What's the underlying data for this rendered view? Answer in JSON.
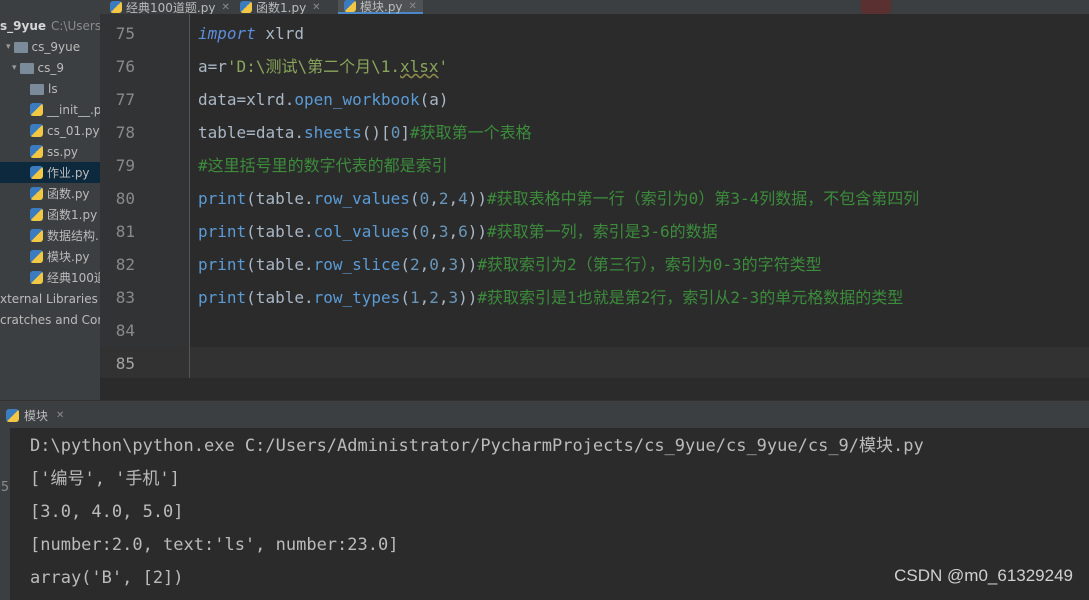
{
  "tabs": [
    {
      "label": "经典100道题.py",
      "active": false
    },
    {
      "label": "函数1.py",
      "active": false
    },
    {
      "label": "模块.py",
      "active": true
    }
  ],
  "project_tree": [
    {
      "label": "s_9yue",
      "note": "C:\\Users\\",
      "type": "root"
    },
    {
      "label": "cs_9yue",
      "type": "folder"
    },
    {
      "label": "cs_9",
      "type": "folder"
    },
    {
      "label": "ls",
      "type": "folder"
    },
    {
      "label": "__init__.py",
      "type": "py"
    },
    {
      "label": "cs_01.py",
      "type": "py"
    },
    {
      "label": "ss.py",
      "type": "py"
    },
    {
      "label": "作业.py",
      "type": "py",
      "selected": true
    },
    {
      "label": "函数.py",
      "type": "py"
    },
    {
      "label": "函数1.py",
      "type": "py"
    },
    {
      "label": "数据结构.",
      "type": "py"
    },
    {
      "label": "模块.py",
      "type": "py"
    },
    {
      "label": "经典100道",
      "type": "py"
    },
    {
      "label": "xternal Libraries",
      "type": "lib"
    },
    {
      "label": "cratches and Cor",
      "type": "lib"
    }
  ],
  "editor": {
    "current_line": "85",
    "lines": [
      {
        "num": "75",
        "tokens": [
          {
            "t": "import",
            "c": "kwimp"
          },
          {
            "t": " xlrd",
            "c": "op"
          }
        ]
      },
      {
        "num": "76",
        "tokens": [
          {
            "t": "a",
            "c": "op"
          },
          {
            "t": "=",
            "c": "op"
          },
          {
            "t": "r",
            "c": "op"
          },
          {
            "t": "'D:\\测试\\第二个月\\1.",
            "c": "str"
          },
          {
            "t": "xlsx",
            "c": "str und"
          },
          {
            "t": "'",
            "c": "str"
          }
        ]
      },
      {
        "num": "77",
        "tokens": [
          {
            "t": "data",
            "c": "op"
          },
          {
            "t": "=",
            "c": "op"
          },
          {
            "t": "xlrd.",
            "c": "op"
          },
          {
            "t": "open_workbook",
            "c": "fn"
          },
          {
            "t": "(a)",
            "c": "op"
          }
        ]
      },
      {
        "num": "78",
        "tokens": [
          {
            "t": "table",
            "c": "op"
          },
          {
            "t": "=",
            "c": "op"
          },
          {
            "t": "data.",
            "c": "op"
          },
          {
            "t": "sheets",
            "c": "fn"
          },
          {
            "t": "()[",
            "c": "op"
          },
          {
            "t": "0",
            "c": "num"
          },
          {
            "t": "]",
            "c": "op"
          },
          {
            "t": "#获取第一个表格",
            "c": "cmt"
          }
        ]
      },
      {
        "num": "79",
        "tokens": [
          {
            "t": "#这里括号里的数字代表的都是索引",
            "c": "cmt"
          }
        ]
      },
      {
        "num": "80",
        "tokens": [
          {
            "t": "print",
            "c": "fn"
          },
          {
            "t": "(table.",
            "c": "op"
          },
          {
            "t": "row_values",
            "c": "fn"
          },
          {
            "t": "(",
            "c": "op"
          },
          {
            "t": "0",
            "c": "num"
          },
          {
            "t": ",",
            "c": "op"
          },
          {
            "t": "2",
            "c": "num"
          },
          {
            "t": ",",
            "c": "op"
          },
          {
            "t": "4",
            "c": "num"
          },
          {
            "t": "))",
            "c": "op"
          },
          {
            "t": "#获取表格中第一行（索引为0）第3-4列数据，不包含第四列",
            "c": "cmt"
          }
        ]
      },
      {
        "num": "81",
        "tokens": [
          {
            "t": "print",
            "c": "fn"
          },
          {
            "t": "(table.",
            "c": "op"
          },
          {
            "t": "col_values",
            "c": "fn"
          },
          {
            "t": "(",
            "c": "op"
          },
          {
            "t": "0",
            "c": "num"
          },
          {
            "t": ",",
            "c": "op"
          },
          {
            "t": "3",
            "c": "num"
          },
          {
            "t": ",",
            "c": "op"
          },
          {
            "t": "6",
            "c": "num"
          },
          {
            "t": "))",
            "c": "op"
          },
          {
            "t": "#获取第一列，索引是3-6的数据",
            "c": "cmt"
          }
        ]
      },
      {
        "num": "82",
        "tokens": [
          {
            "t": "print",
            "c": "fn"
          },
          {
            "t": "(table.",
            "c": "op"
          },
          {
            "t": "row_slice",
            "c": "fn"
          },
          {
            "t": "(",
            "c": "op"
          },
          {
            "t": "2",
            "c": "num"
          },
          {
            "t": ",",
            "c": "op"
          },
          {
            "t": "0",
            "c": "num"
          },
          {
            "t": ",",
            "c": "op"
          },
          {
            "t": "3",
            "c": "num"
          },
          {
            "t": "))",
            "c": "op"
          },
          {
            "t": "#获取索引为2（第三行），索引为0-3的字符类型",
            "c": "cmt"
          }
        ]
      },
      {
        "num": "83",
        "tokens": [
          {
            "t": "print",
            "c": "fn"
          },
          {
            "t": "(table.",
            "c": "op"
          },
          {
            "t": "row_types",
            "c": "fn"
          },
          {
            "t": "(",
            "c": "op"
          },
          {
            "t": "1",
            "c": "num"
          },
          {
            "t": ",",
            "c": "op"
          },
          {
            "t": "2",
            "c": "num"
          },
          {
            "t": ",",
            "c": "op"
          },
          {
            "t": "3",
            "c": "num"
          },
          {
            "t": "))",
            "c": "op"
          },
          {
            "t": "#获取索引是1也就是第2行，索引从2-3的单元格数据的类型",
            "c": "cmt"
          }
        ]
      },
      {
        "num": "84",
        "tokens": []
      },
      {
        "num": "85",
        "tokens": []
      }
    ]
  },
  "run_panel": {
    "tab_label": "模块",
    "output": [
      "D:\\python\\python.exe C:/Users/Administrator/PycharmProjects/cs_9yue/cs_9yue/cs_9/模块.py",
      "['编号', '手机']",
      "[3.0, 4.0, 5.0]",
      "[number:2.0, text:'ls', number:23.0]",
      "array('B', [2])"
    ]
  },
  "watermark": "CSDN @m0_61329249"
}
